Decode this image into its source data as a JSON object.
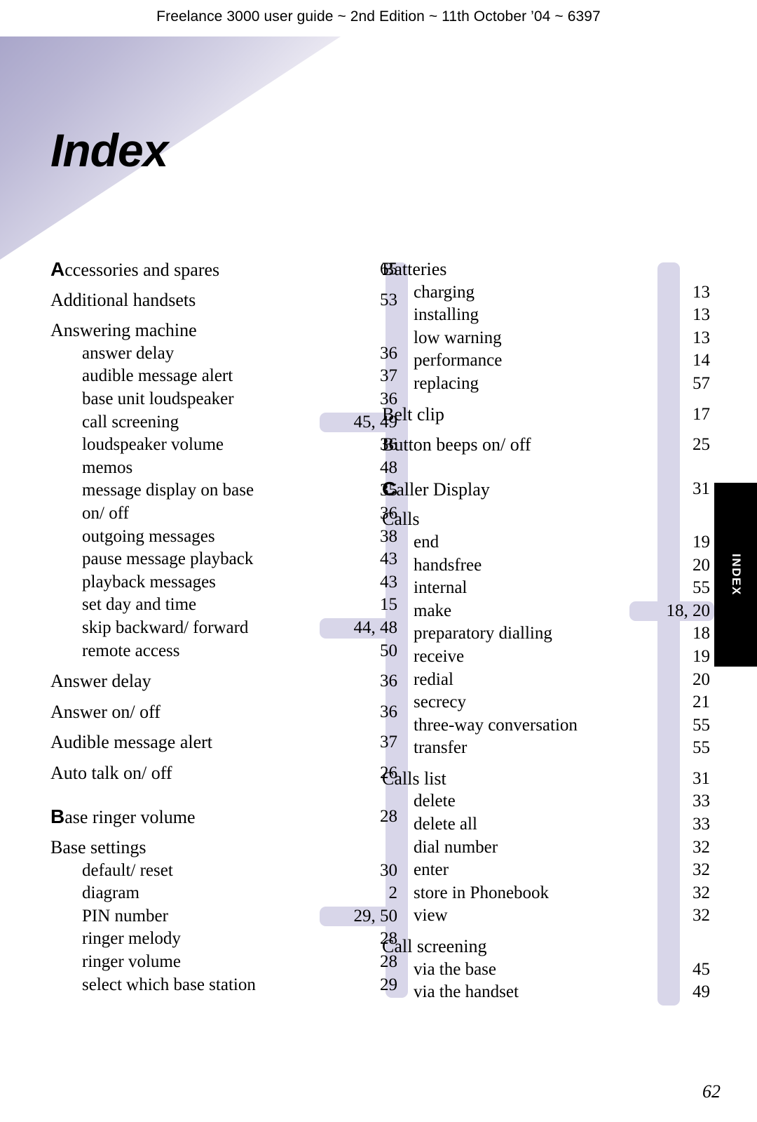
{
  "running_head": "Freelance 3000 user guide ~ 2nd Edition ~ 11th October ’04 ~ 6397",
  "page_title": "Index",
  "side_tab": {
    "label": "INDEX"
  },
  "folio": "62",
  "colors": {
    "band": "#d8d6e9",
    "tab_background": "#000000",
    "tab_text": "#ffffff"
  },
  "index": {
    "left_column": [
      {
        "initial": "A",
        "label": "ccessories and spares",
        "pages": "65",
        "level": "head"
      },
      {
        "label": "Additional handsets",
        "pages": "53",
        "level": "head",
        "gap": "above"
      },
      {
        "label": "Answering machine",
        "pages": "",
        "level": "head",
        "gap": "above"
      },
      {
        "label": "answer delay",
        "pages": "36",
        "level": "sub"
      },
      {
        "label": "audible message alert",
        "pages": "37",
        "level": "sub"
      },
      {
        "label": "base unit loudspeaker",
        "pages": "36",
        "level": "sub"
      },
      {
        "label": "call screening",
        "pages": "45, 49",
        "level": "sub",
        "wide": true
      },
      {
        "label": "loudspeaker volume",
        "pages": "36",
        "level": "sub"
      },
      {
        "label": "memos",
        "pages": "48",
        "level": "sub"
      },
      {
        "label": "message display on base",
        "pages": "35",
        "level": "sub"
      },
      {
        "label": "on/ off",
        "pages": "36",
        "level": "sub"
      },
      {
        "label": "outgoing messages",
        "pages": "38",
        "level": "sub"
      },
      {
        "label": "pause message playback",
        "pages": "43",
        "level": "sub"
      },
      {
        "label": "playback messages",
        "pages": "43",
        "level": "sub"
      },
      {
        "label": "set day and time",
        "pages": "15",
        "level": "sub"
      },
      {
        "label": "skip backward/ forward",
        "pages": "44, 48",
        "level": "sub",
        "wide": true
      },
      {
        "label": "remote access",
        "pages": "50",
        "level": "sub"
      },
      {
        "label": "Answer delay",
        "pages": "36",
        "level": "head",
        "gap": "above"
      },
      {
        "label": "Answer on/ off",
        "pages": "36",
        "level": "head",
        "gap": "above"
      },
      {
        "label": "Audible message alert",
        "pages": "37",
        "level": "head",
        "gap": "above"
      },
      {
        "label": "Auto talk on/ off",
        "pages": "26",
        "level": "head",
        "gap": "above"
      },
      {
        "initial": "B",
        "label": "ase ringer volume",
        "pages": "28",
        "level": "head",
        "gap": "sect"
      },
      {
        "label": "Base settings",
        "pages": "",
        "level": "head",
        "gap": "above"
      },
      {
        "label": "default/ reset",
        "pages": "30",
        "level": "sub"
      },
      {
        "label": "diagram",
        "pages": "2",
        "level": "sub"
      },
      {
        "label": "PIN number",
        "pages": "29, 50",
        "level": "sub",
        "wide": true
      },
      {
        "label": "ringer melody",
        "pages": "28",
        "level": "sub"
      },
      {
        "label": "ringer volume",
        "pages": "28",
        "level": "sub"
      },
      {
        "label": "select which base station",
        "pages": "29",
        "level": "sub"
      }
    ],
    "right_column": [
      {
        "label": "Batteries",
        "pages": "",
        "level": "head"
      },
      {
        "label": "charging",
        "pages": "13",
        "level": "sub"
      },
      {
        "label": "installing",
        "pages": "13",
        "level": "sub"
      },
      {
        "label": "low warning",
        "pages": "13",
        "level": "sub"
      },
      {
        "label": "performance",
        "pages": "14",
        "level": "sub"
      },
      {
        "label": "replacing",
        "pages": "57",
        "level": "sub"
      },
      {
        "label": "Belt clip",
        "pages": "17",
        "level": "head",
        "gap": "above"
      },
      {
        "label": "Button beeps on/ off",
        "pages": "25",
        "level": "head",
        "gap": "above"
      },
      {
        "initial": "C",
        "label": "aller Display",
        "pages": "31",
        "level": "head",
        "gap": "sect"
      },
      {
        "label": "Calls",
        "pages": "",
        "level": "head",
        "gap": "above"
      },
      {
        "label": "end",
        "pages": "19",
        "level": "sub"
      },
      {
        "label": "handsfree",
        "pages": "20",
        "level": "sub"
      },
      {
        "label": "internal",
        "pages": "55",
        "level": "sub"
      },
      {
        "label": "make",
        "pages": "18, 20",
        "level": "sub",
        "wide": true
      },
      {
        "label": "preparatory dialling",
        "pages": "18",
        "level": "sub"
      },
      {
        "label": "receive",
        "pages": "19",
        "level": "sub"
      },
      {
        "label": "redial",
        "pages": "20",
        "level": "sub"
      },
      {
        "label": "secrecy",
        "pages": "21",
        "level": "sub"
      },
      {
        "label": "three-way conversation",
        "pages": "55",
        "level": "sub"
      },
      {
        "label": "transfer",
        "pages": "55",
        "level": "sub"
      },
      {
        "label": "Calls list",
        "pages": "31",
        "level": "head",
        "gap": "above"
      },
      {
        "label": "delete",
        "pages": "33",
        "level": "sub"
      },
      {
        "label": "delete all",
        "pages": "33",
        "level": "sub"
      },
      {
        "label": "dial number",
        "pages": "32",
        "level": "sub"
      },
      {
        "label": "enter",
        "pages": "32",
        "level": "sub"
      },
      {
        "label": "store in Phonebook",
        "pages": "32",
        "level": "sub"
      },
      {
        "label": "view",
        "pages": "32",
        "level": "sub"
      },
      {
        "label": "Call screening",
        "pages": "",
        "level": "head",
        "gap": "above"
      },
      {
        "label": "via the base",
        "pages": "45",
        "level": "sub"
      },
      {
        "label": "via the handset",
        "pages": "49",
        "level": "sub"
      }
    ]
  }
}
